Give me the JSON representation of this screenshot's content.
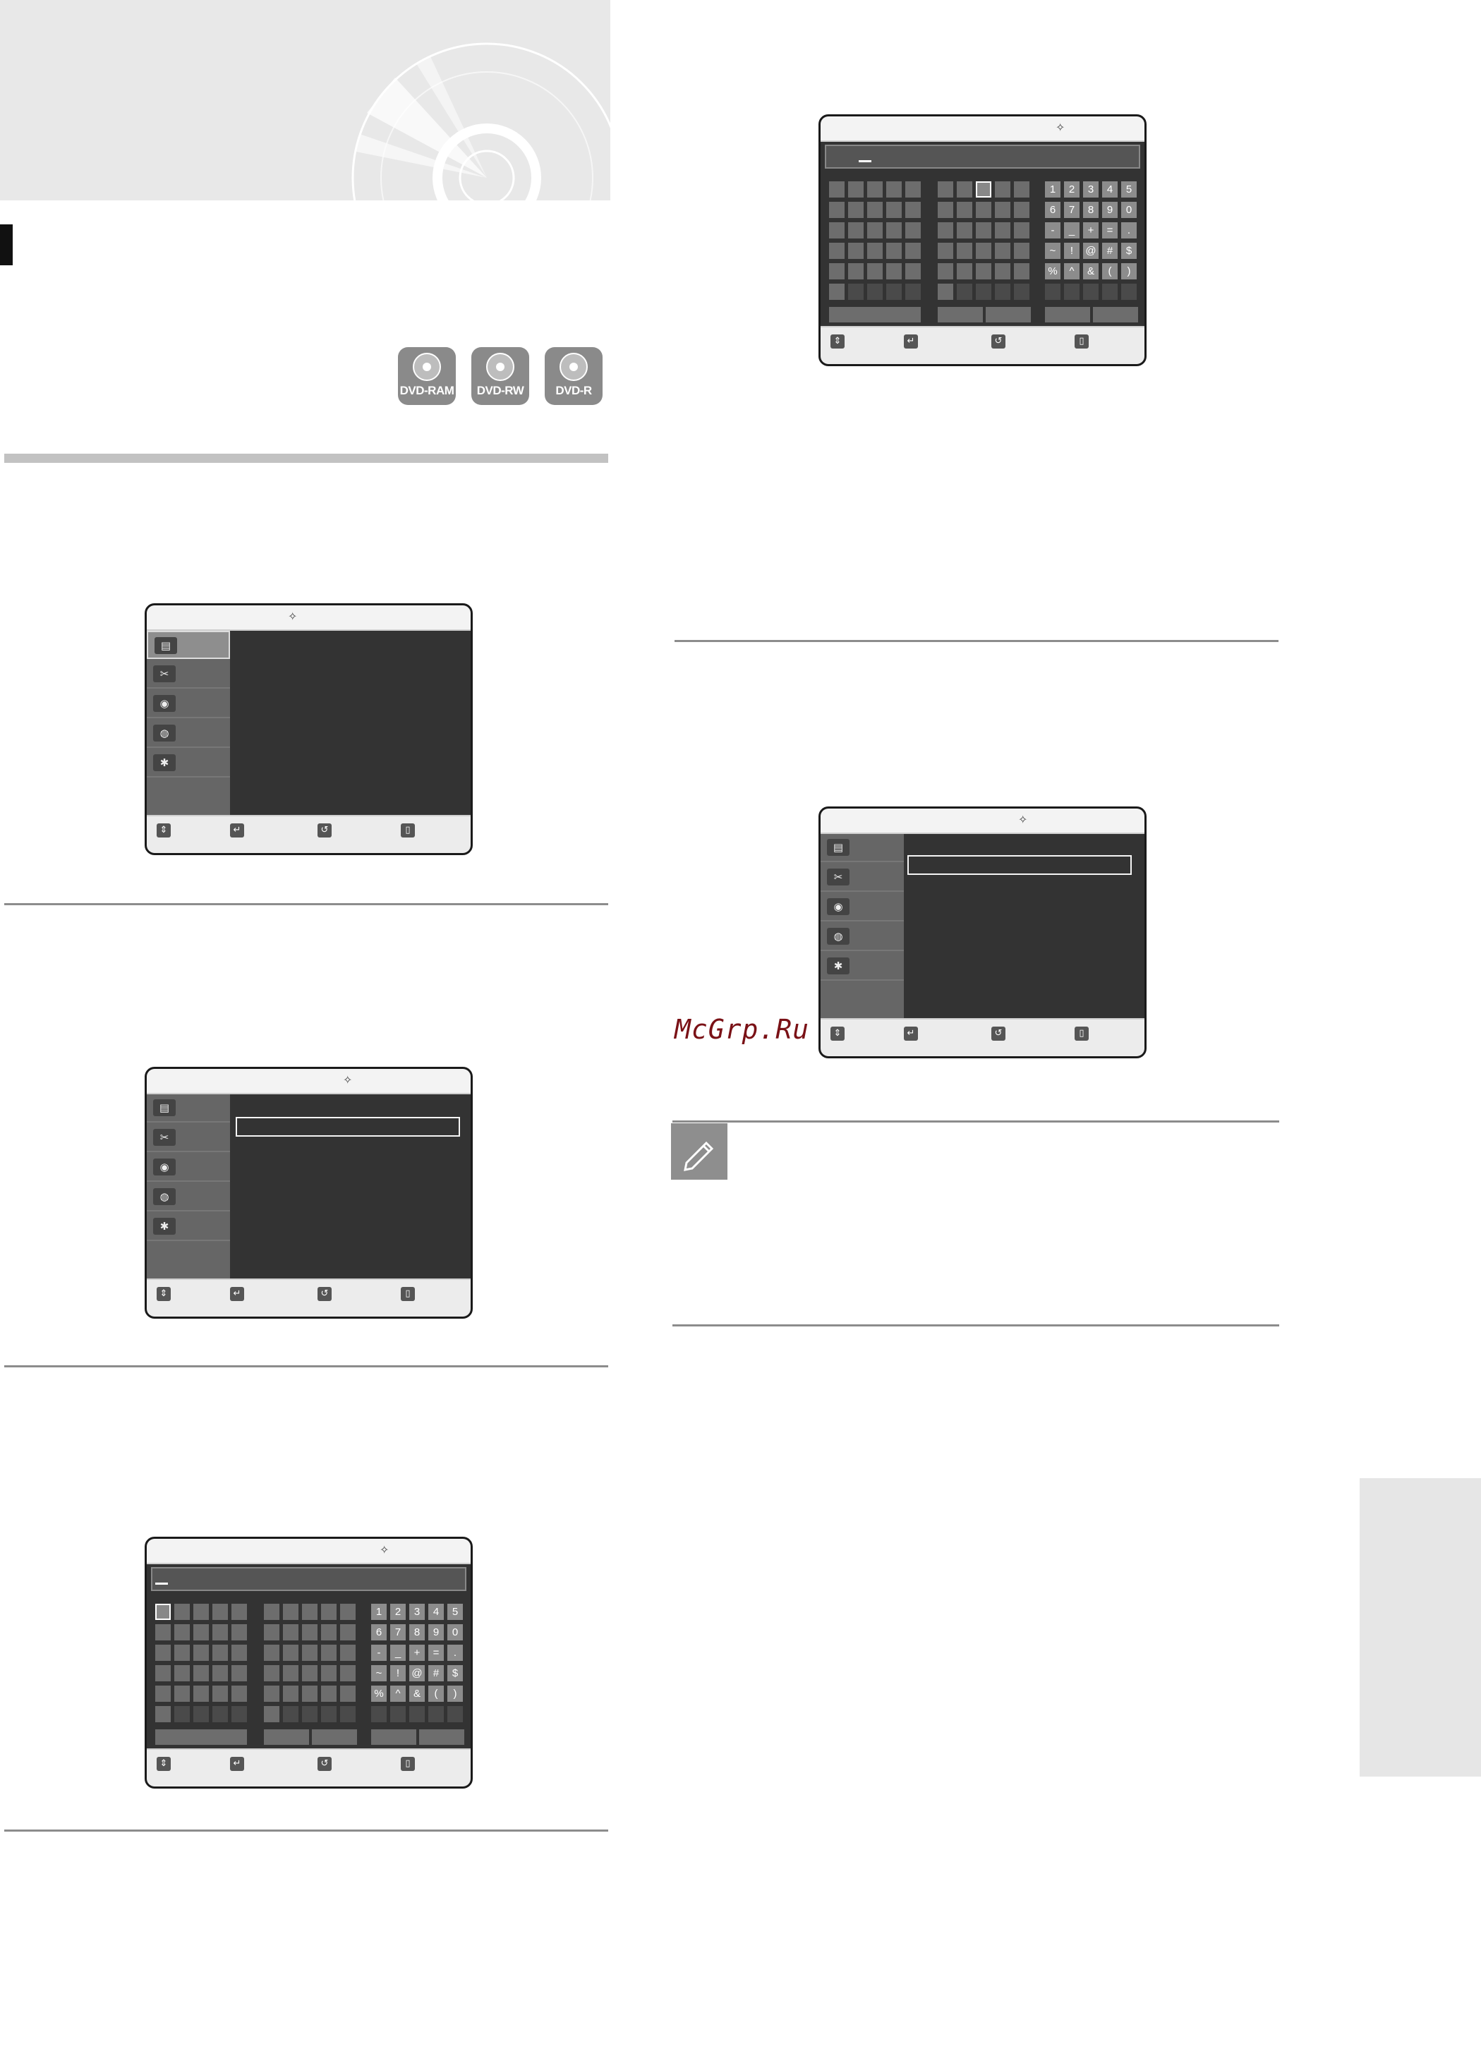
{
  "disc_badges": [
    "DVD-RAM",
    "DVD-RW",
    "DVD-R"
  ],
  "screen_icons": {
    "menu": [
      "film-strip-icon",
      "edit-cut-icon",
      "disc-icon",
      "disc-manager-icon",
      "gear-icon"
    ],
    "menu_glyphs": [
      "▤",
      "✂",
      "◉",
      "◍",
      "✱"
    ],
    "bottom": [
      "move-icon",
      "enter-icon",
      "return-icon",
      "exit-icon"
    ],
    "bottom_glyphs": [
      "⇕",
      "↵",
      "↺",
      "▯"
    ]
  },
  "keyboard": {
    "numeric_keys": [
      [
        "1",
        "2",
        "3",
        "4",
        "5"
      ],
      [
        "6",
        "7",
        "8",
        "9",
        "0"
      ],
      [
        "-",
        "_",
        "+",
        "=",
        "."
      ],
      [
        "~",
        "!",
        "@",
        "#",
        "$"
      ],
      [
        "%",
        "^",
        "&",
        "(",
        ")"
      ]
    ]
  },
  "watermark": "McGrp.Ru",
  "note_icon": "pencil-note-icon",
  "colors": {
    "screen_body": "#333333",
    "screen_side": "#666666",
    "watermark": "#7a1116",
    "badge": "#8a8a8a"
  }
}
